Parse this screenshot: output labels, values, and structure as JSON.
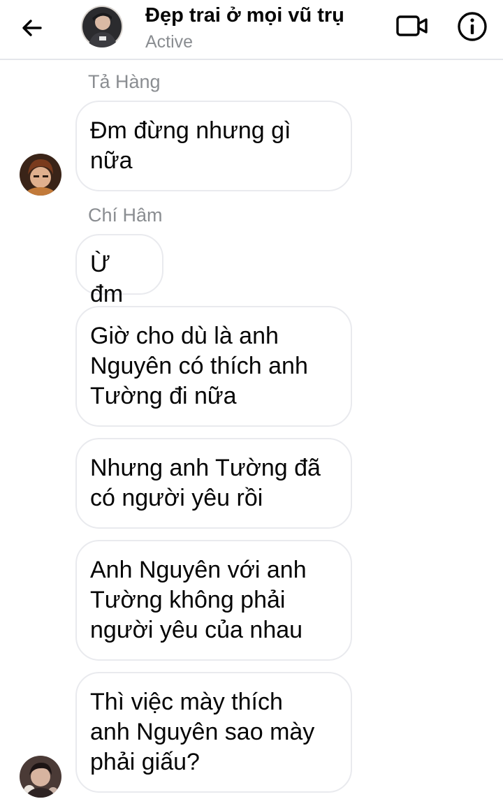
{
  "header": {
    "back_icon": "arrow-left-icon",
    "title": "Đẹp trai ở mọi vũ trụ",
    "status": "Active",
    "video_icon": "video-camera-icon",
    "info_icon": "info-icon"
  },
  "messages": [
    {
      "sender": "Tả Hàng",
      "text": "Đm đừng nhưng gì\nnữa"
    },
    {
      "sender": "Chí Hâm",
      "text": "Ừ đm"
    },
    {
      "text": "Giờ cho dù là anh\nNguyên có thích anh\nTường đi nữa"
    },
    {
      "text": "Nhưng anh Tường đã\ncó người yêu rồi"
    },
    {
      "text": "Anh Nguyên với anh\nTường không phải\nngười yêu của nhau"
    },
    {
      "text": "Thì việc mày thích\nanh Nguyên sao mày\nphải giấu?"
    }
  ],
  "colors": {
    "bubble_border": "#e9eaee",
    "secondary_text": "#8a8d91",
    "divider": "#e4e6eb"
  }
}
